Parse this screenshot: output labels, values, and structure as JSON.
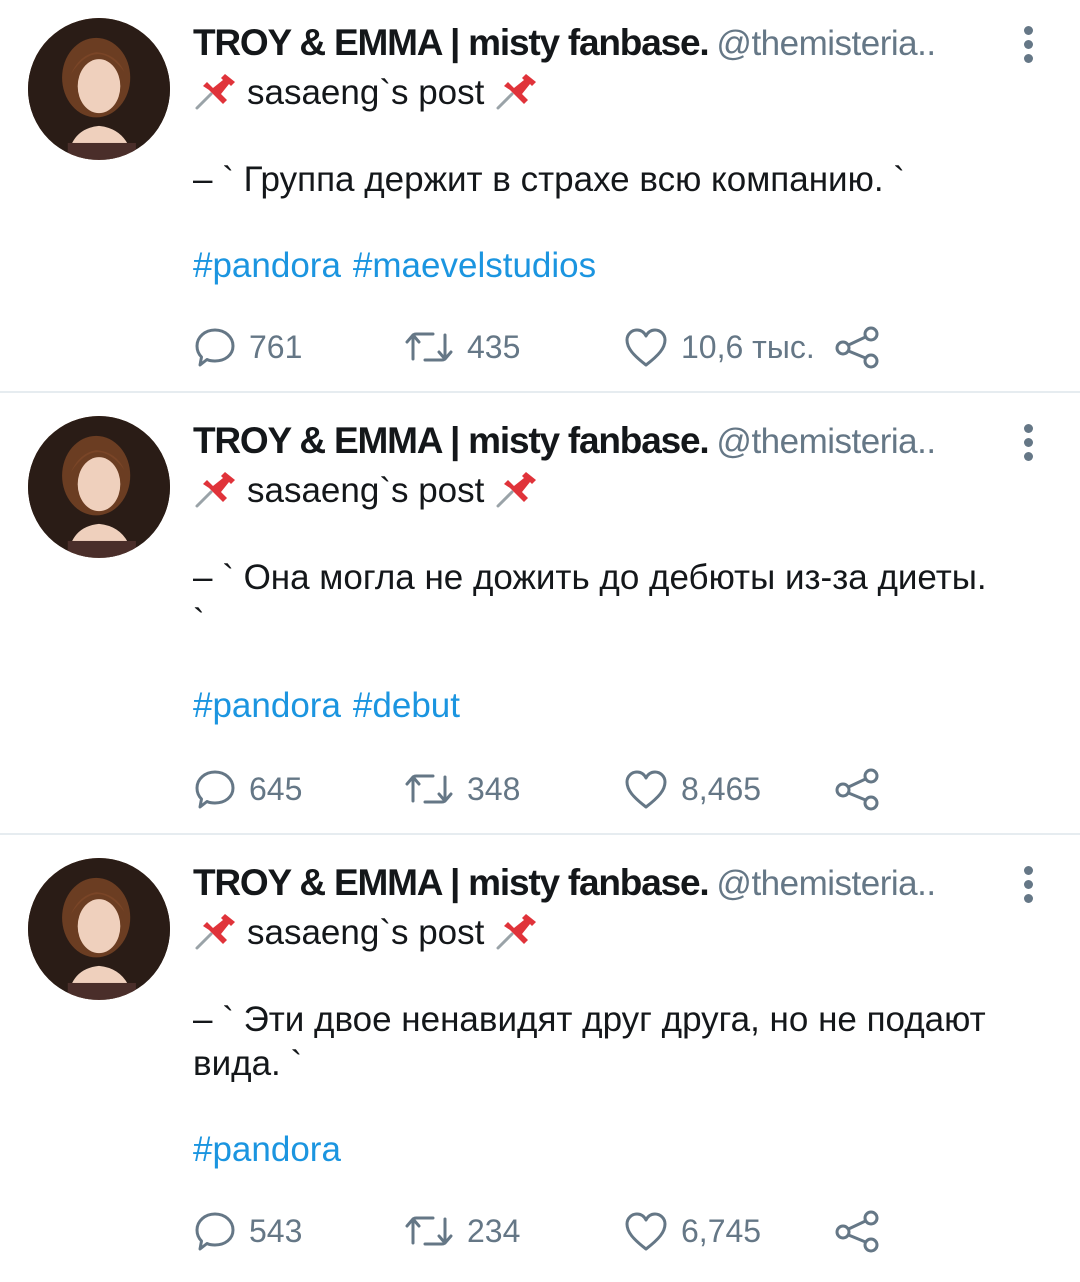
{
  "tweets": [
    {
      "author_name": "TROY & EMMA | misty fanbase.",
      "handle": "@themisteria..",
      "pinned_label": "sasaeng`s post",
      "text": "– ` Группа держит в страхе всю компанию. `",
      "hashtags": [
        "#pandora",
        "#maevelstudios"
      ],
      "replies": "761",
      "retweets": "435",
      "likes": "10,6 тыс."
    },
    {
      "author_name": "TROY & EMMA | misty fanbase.",
      "handle": "@themisteria..",
      "pinned_label": "sasaeng`s post",
      "text": "– ` Она могла не дожить до дебюты из-за диеты. `",
      "hashtags": [
        "#pandora",
        "#debut"
      ],
      "replies": "645",
      "retweets": "348",
      "likes": "8,465"
    },
    {
      "author_name": "TROY & EMMA | misty fanbase.",
      "handle": "@themisteria..",
      "pinned_label": "sasaeng`s post",
      "text": "– ` Эти двое ненавидят друг друга, но не подают вида. `",
      "hashtags": [
        "#pandora"
      ],
      "replies": "543",
      "retweets": "234",
      "likes": "6,745"
    }
  ],
  "icons": {
    "reply": "speech-bubble-icon",
    "retweet": "retweet-arrows-icon",
    "like": "heart-icon",
    "share": "share-nodes-icon",
    "more": "vertical-ellipsis-icon",
    "pin": "pushpin-emoji-icon"
  },
  "colors": {
    "hashtag": "#1b95e0",
    "secondary_text": "#657786",
    "primary_text": "#14171a",
    "pin_red": "#e0333a",
    "divider": "#e6ecf0"
  }
}
